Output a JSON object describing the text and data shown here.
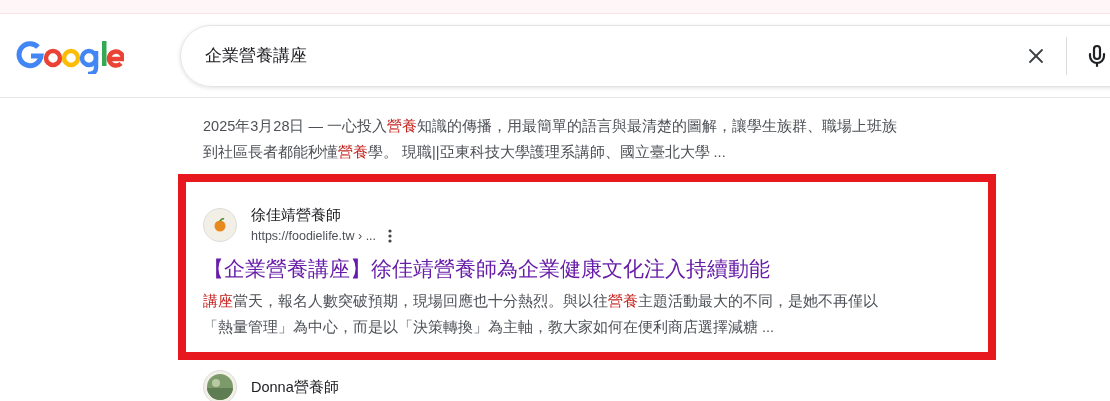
{
  "search": {
    "value": "企業營養講座"
  },
  "results": [
    {
      "kind": "partial",
      "snippet": [
        "2025年3月28日 — 一心投入**營養**知識的傳播，用最簡單的語言與最清楚的圖解，讓學生族群、職場上班族",
        "到社區長者都能秒懂**營養**學。 現職||亞東科技大學護理系講師、國立臺北大學 ..."
      ]
    },
    {
      "kind": "full",
      "highlighted": true,
      "site": "徐佳靖營養師",
      "url": "https://foodielife.tw › ...",
      "title": "【企業營養講座】徐佳靖營養師為企業健康文化注入持續動能",
      "snippet": [
        "**講座**當天，報名人數突破預期，現場回應也十分熱烈。與以往**營養**主題活動最大的不同，是她不再僅以",
        "「熱量管理」為中心，而是以「決策轉換」為主軸，教大家如何在便利商店選擇減糖 ..."
      ]
    },
    {
      "kind": "site-only",
      "site": "Donna營養師"
    }
  ]
}
